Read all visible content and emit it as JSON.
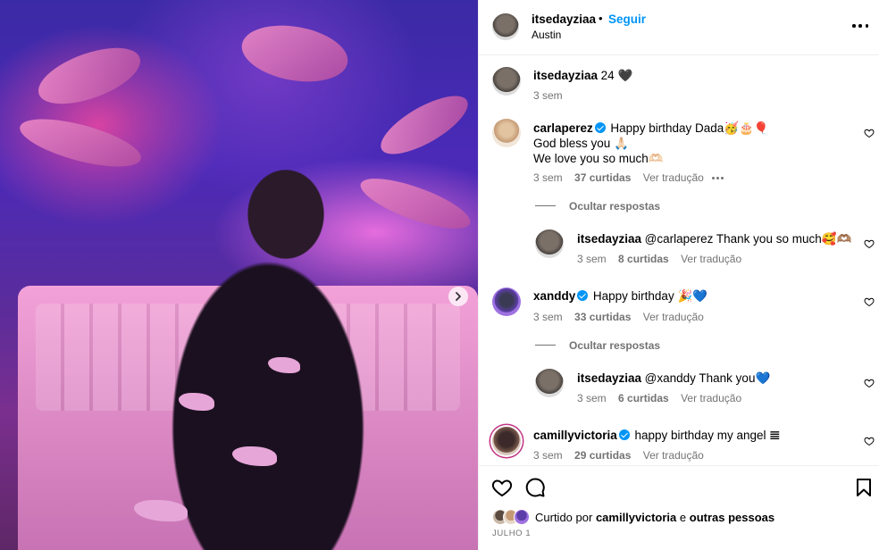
{
  "header": {
    "username": "itsedayziaa",
    "dot": "•",
    "follow_label": "Seguir",
    "location": "Austin"
  },
  "caption": {
    "username": "itsedayziaa",
    "text": "24 🖤",
    "time": "3 sem"
  },
  "comments": [
    {
      "username": "carlaperez",
      "verified": true,
      "line1": "Happy birthday Dada🥳🎂🎈",
      "line2": "God bless you 🙏🏻",
      "line3": "We love you so much🫶🏻",
      "time": "3 sem",
      "likes": "37 curtidas",
      "translate": "Ver tradução",
      "hide_replies": "Ocultar respostas",
      "reply": {
        "username": "itsedayziaa",
        "text": "@carlaperez Thank you so much🥰🫶🏽",
        "time": "3 sem",
        "likes": "8 curtidas",
        "translate": "Ver tradução"
      }
    },
    {
      "username": "xanddy",
      "verified": true,
      "line1": "Happy birthday 🎉💙",
      "time": "3 sem",
      "likes": "33 curtidas",
      "translate": "Ver tradução",
      "hide_replies": "Ocultar respostas",
      "reply": {
        "username": "itsedayziaa",
        "text": "@xanddy Thank you💙",
        "time": "3 sem",
        "likes": "6 curtidas",
        "translate": "Ver tradução"
      }
    },
    {
      "username": "camillyvictoria",
      "verified": true,
      "line1": "happy birthday my angel 𝌆",
      "time": "3 sem",
      "likes": "29 curtidas",
      "translate": "Ver tradução"
    }
  ],
  "footer": {
    "liked_prefix": "Curtido por",
    "liked_user": "camillyvictoria",
    "liked_and": "e",
    "liked_others": "outras pessoas",
    "date": "JULHO 1"
  },
  "colors": {
    "accent": "#0095f6",
    "muted": "#737373",
    "border": "#efefef"
  },
  "icons": [
    "chevron-right-icon",
    "more-icon",
    "heart-icon",
    "comment-icon",
    "bookmark-icon",
    "verified-icon"
  ]
}
